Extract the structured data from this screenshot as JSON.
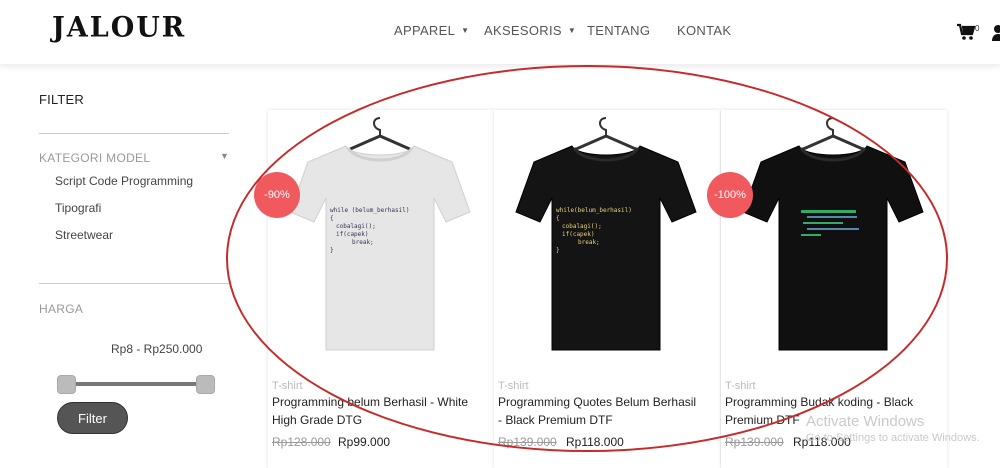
{
  "header": {
    "logo": "JALOUR",
    "nav": [
      {
        "label": "APPAREL",
        "has_dropdown": true
      },
      {
        "label": "AKSESORIS",
        "has_dropdown": true
      },
      {
        "label": "TENTANG",
        "has_dropdown": false
      },
      {
        "label": "KONTAK",
        "has_dropdown": false
      }
    ],
    "cart_count": "0",
    "icons": {
      "cart": "cart-icon",
      "user": "user-icon",
      "dropdown": "caret-down-icon"
    }
  },
  "sidebar": {
    "filter_title": "FILTER",
    "category_title": "KATEGORI MODEL",
    "categories": [
      "Script Code Programming",
      "Tipografi",
      "Streetwear"
    ],
    "price_title": "HARGA",
    "price_range": "Rp8 - Rp250.000",
    "slider": {
      "min_fraction": 0,
      "max_fraction": 1
    },
    "filter_button": "Filter"
  },
  "products": [
    {
      "badge": "-90%",
      "type": "T-shirt",
      "name": "Programming belum Berhasil - White High Grade DTG",
      "old_price": "Rp128.000",
      "price": "Rp99.000",
      "shirt_color": "#e6e6e6",
      "shirt_code": [
        "while (belum_berhasil)",
        "{",
        "cobalagi();",
        "if(capek)",
        "break;",
        "}"
      ]
    },
    {
      "badge": "",
      "type": "T-shirt",
      "name": "Programming Quotes Belum Berhasil - Black Premium DTF",
      "old_price": "Rp139.000",
      "price": "Rp118.000",
      "shirt_color": "#141414",
      "shirt_code": [
        "while(belum_berhasil)",
        "{",
        "cobalagi();",
        "if(capek)",
        "break;",
        "}"
      ]
    },
    {
      "badge": "-100%",
      "type": "T-shirt",
      "name": "Programming Budak koding - Black Premium DTF",
      "old_price": "Rp139.000",
      "price": "Rp118.000",
      "shirt_color": "#101010",
      "shirt_code": []
    }
  ],
  "watermark": {
    "line1": "Activate Windows",
    "line2": "Go to Settings to activate Windows."
  },
  "colors": {
    "badge": "#f05a5f",
    "annotation_circle": "#c42b2b",
    "filter_button": "#555555"
  }
}
